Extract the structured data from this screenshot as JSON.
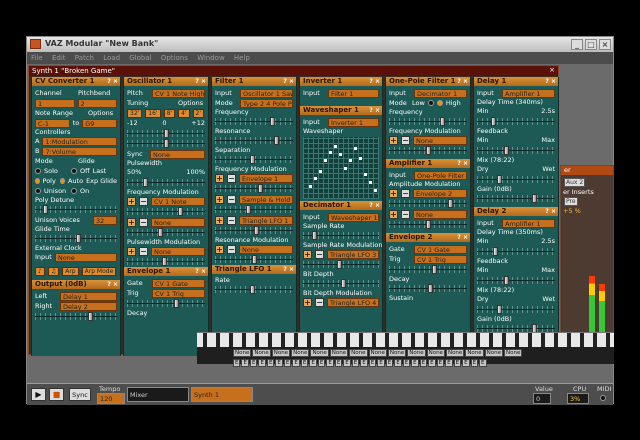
{
  "window": {
    "title": "VAZ Modular \"New Bank\""
  },
  "menu": [
    "File",
    "Edit",
    "Patch",
    "Load",
    "Global",
    "Options",
    "Window",
    "Help"
  ],
  "synth": {
    "title": "Synth 1 \"Broken Game\""
  },
  "cv_converter": {
    "title": "CV Converter 1",
    "channel_label": "Channel",
    "channel_value": "1",
    "pitchbend_label": "Pitchbend",
    "pitchbend_value": "2",
    "note_range_label": "Note Range",
    "options_label": "Options",
    "range_from": "C-1",
    "range_to_label": "to",
    "range_to": "G9",
    "controllers_label": "Controllers",
    "ctrl_a_label": "A",
    "ctrl_a": "1:Modulation",
    "ctrl_b_label": "B",
    "ctrl_b": "7:Volume",
    "mode_label": "Mode",
    "glide_label": "Glide",
    "solo": "Solo",
    "poly": "Poly",
    "unison": "Unison",
    "off": "Off",
    "auto": "Auto",
    "on": "On",
    "last": "Last",
    "exp_glide": "Exp Glide",
    "poly_detune": "Poly Detune",
    "unison_voices_label": "Unison Voices",
    "unison_voices": "32",
    "glide_time": "Glide Time",
    "ext_clock": "External Clock",
    "input_label": "Input",
    "input_value": "None",
    "arp_label": "Arp",
    "arp_mode": "Arp Mode"
  },
  "output": {
    "title": "Output (0dB)",
    "left_label": "Left",
    "left": "Delay 1",
    "right_label": "Right",
    "right": "Delay 2"
  },
  "oscillator": {
    "title": "Oscillator 1",
    "pitch_label": "Pitch",
    "pitch": "CV 1 Note High",
    "tuning_label": "Tuning",
    "options_label": "Options",
    "tuning_btns": [
      "32'",
      "16'",
      "8'",
      "4'",
      "2'"
    ],
    "tuning_min": "-12",
    "tuning_zero": "0",
    "tuning_max": "+12",
    "sync_label": "Sync",
    "sync": "None",
    "pulsewidth": "Pulsewidth",
    "pw_min": "50%",
    "pw_max": "100%",
    "freq_mod": "Frequency Modulation",
    "fm1": "CV 1 Note",
    "fm2": "None",
    "pw_mod": "Pulsewidth Modulation",
    "pwm1": "None"
  },
  "envelope1": {
    "title": "Envelope 1",
    "gate_label": "Gate",
    "gate": "CV 1 Gate",
    "trig_label": "Trig",
    "trig": "CV 1 Trig",
    "decay": "Decay"
  },
  "filter": {
    "title": "Filter 1",
    "input_label": "Input",
    "input": "Oscillator 1 Saw",
    "mode_label": "Mode",
    "mode": "Type 2 4 Pole PM",
    "frequency": "Frequency",
    "resonance": "Resonance",
    "separation": "Separation",
    "freq_mod": "Frequency Modulation",
    "fm1": "Envelope 1",
    "fm2": "Sample & Hold 1",
    "fm3": "Triangle LFO 1",
    "res_mod": "Resonance Modulation",
    "rm1": "None"
  },
  "triangle_lfo": {
    "title": "Triangle LFO 1",
    "rate": "Rate"
  },
  "inverter": {
    "title": "Inverter 1",
    "input_label": "Input",
    "input": "Filter 1"
  },
  "waveshaper": {
    "title": "Waveshaper 1",
    "input_label": "Input",
    "input": "Inverter 1",
    "label": "Waveshaper"
  },
  "decimator": {
    "title": "Decimator 1",
    "input_label": "Input",
    "input": "Waveshaper 1",
    "sample_rate": "Sample Rate",
    "srm": "Sample Rate Modulation",
    "srm1": "Triangle LFO 3",
    "bit_depth": "Bit Depth",
    "bdm": "Bit Depth Modulation",
    "bdm1": "Triangle LFO 4"
  },
  "onepole": {
    "title": "One-Pole Filter 1",
    "input_label": "Input",
    "input": "Decimator 1",
    "mode_label": "Mode",
    "low": "Low",
    "high": "High",
    "frequency": "Frequency",
    "freq_mod": "Frequency Modulation",
    "fm1": "None"
  },
  "amplifier": {
    "title": "Amplifier 1",
    "input_label": "Input",
    "input": "One-Pole Filter 1",
    "amp_mod": "Amplitude Modulation",
    "am1": "Envelope 2",
    "am2": "None"
  },
  "envelope2": {
    "title": "Envelope 2",
    "gate_label": "Gate",
    "gate": "CV 1 Gate",
    "trig_label": "Trig",
    "trig": "CV 1 Trig",
    "decay": "Decay",
    "sustain": "Sustain"
  },
  "delay1": {
    "title": "Delay 1",
    "input_label": "Input",
    "input": "Amplifier 1",
    "delay_time": "Delay Time (340ms)",
    "min": "Min",
    "max": "2.5s",
    "feedback": "Feedback",
    "fmin": "Min",
    "fmax": "Max",
    "mix": "Mix (78:22)",
    "dry": "Dry",
    "wet": "Wet",
    "gain": "Gain (0dB)"
  },
  "delay2": {
    "title": "Delay 2",
    "input_label": "Input",
    "input": "Amplifier 1",
    "delay_time": "Delay Time (350ms)",
    "min": "Min",
    "max": "2.5s",
    "feedback": "Feedback",
    "fmin": "Min",
    "fmax": "Max",
    "mix": "Mix (78:22)",
    "dry": "Dry",
    "wet": "Wet",
    "gain": "Gain (0dB)"
  },
  "rightpanel": {
    "title": "er",
    "aux2": "Aux 2",
    "inserts": "er Inserts",
    "pre": "Pre",
    "value": "+5 %"
  },
  "mixer_strip": {
    "none_label": "None",
    "e_label": "E"
  },
  "transport": {
    "sync": "Sync",
    "tempo_label": "Tempo",
    "tempo": "120",
    "mixer": "Mixer",
    "synth1": "Synth 1",
    "value_label": "Value",
    "value": "0",
    "cpu_label": "CPU",
    "cpu": "3%",
    "midi_label": "MIDI"
  }
}
